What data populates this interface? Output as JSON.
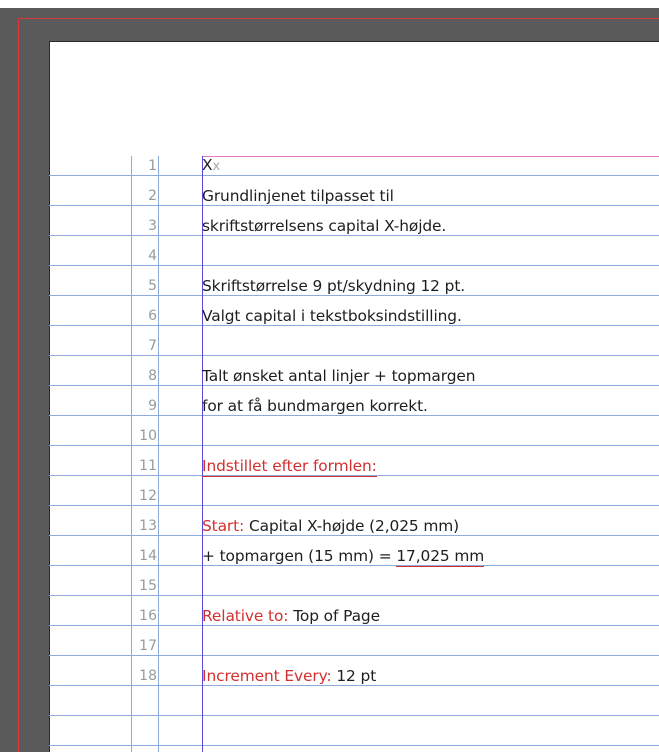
{
  "line_numbers": [
    "1",
    "2",
    "3",
    "4",
    "5",
    "6",
    "7",
    "8",
    "9",
    "10",
    "11",
    "12",
    "13",
    "14",
    "15",
    "16",
    "17",
    "18"
  ],
  "text": {
    "l1_a": "X",
    "l1_b": "x",
    "l2": "Grundlinjenet tilpasset til",
    "l3": "skriftstørrelsens capital X-højde.",
    "l5": "Skriftstørrelse 9 pt/skydning 12 pt.",
    "l6": "Valgt capital i tekstboksindstilling.",
    "l8": "Talt ønsket antal linjer + topmargen",
    "l9": "for at få bundmargen korrekt.",
    "l11": "Indstillet efter formlen:",
    "l13_label": "Start:",
    "l13_value": " Capital X-højde (2,025 mm)",
    "l14_value": "+ topmargen (15 mm) = ",
    "l14_result": "17,025 mm",
    "l16_label": "Relative to:",
    "l16_value": " Top of Page",
    "l18_label": "Increment Every:",
    "l18_value": " 12 pt"
  },
  "colors": {
    "pasteboard": "#5a5a5a",
    "baseline_grid": "#8faadc",
    "margin_guide": "#e879c8",
    "frame_edge": "#5b4bdc",
    "accent_red": "#d03030",
    "bleed_guide": "#d83a3a"
  }
}
